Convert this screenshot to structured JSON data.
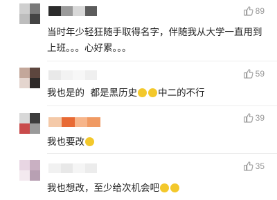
{
  "colors": {
    "like_gray": "#999999",
    "emoji_yellow": "#f3c82b",
    "divider": "#ececec"
  },
  "comments": [
    {
      "likes": "89",
      "text": "当时年少轻狂随手取得名字，伴随我从大学一直用到上班。。。心好累。。。",
      "emojis": [],
      "avatar_colors": [
        "#cfcfcf",
        "#7a7a7a",
        "#bdbdbd",
        "#444444"
      ],
      "username_colors": [
        "#2b2b2b",
        "#9a9a9a",
        "#d8d8d8",
        "#5c5c5c"
      ]
    },
    {
      "likes": "59",
      "text": "我也是的  都是黑历史",
      "text_after": "中二的不行",
      "emojis": [
        "crying-laughing-emoji",
        "crying-laughing-emoji"
      ],
      "avatar_colors": [
        "#c3a79a",
        "#5d463e",
        "#e4d5ce",
        "#2e2a29"
      ],
      "username_colors": [
        "#e9e9e9",
        "#f2f2f2",
        "#f7f7f7",
        "#efefef"
      ]
    },
    {
      "likes": "39",
      "text": "我也要改",
      "emojis": [
        "thinking-emoji"
      ],
      "avatar_colors": [
        "#d8d8d8",
        "#3d3d3d",
        "#c94b4b",
        "#9a9a9a"
      ],
      "username_colors": [
        "#f4c9a8",
        "#e86a34",
        "#f7b58a",
        "#f09a63"
      ]
    },
    {
      "likes": "35",
      "text": "我也想改，至少给次机会吧",
      "emojis": [
        "laughing-emoji",
        "laughing-emoji"
      ],
      "avatar_colors": [
        "#e8d6e3",
        "#c9b0c2",
        "#f3e9ef",
        "#b8a0b3"
      ],
      "username_colors": [
        "#f1f1f1",
        "#e8e8e8",
        "#f5f5f5",
        "#ececec"
      ]
    }
  ]
}
